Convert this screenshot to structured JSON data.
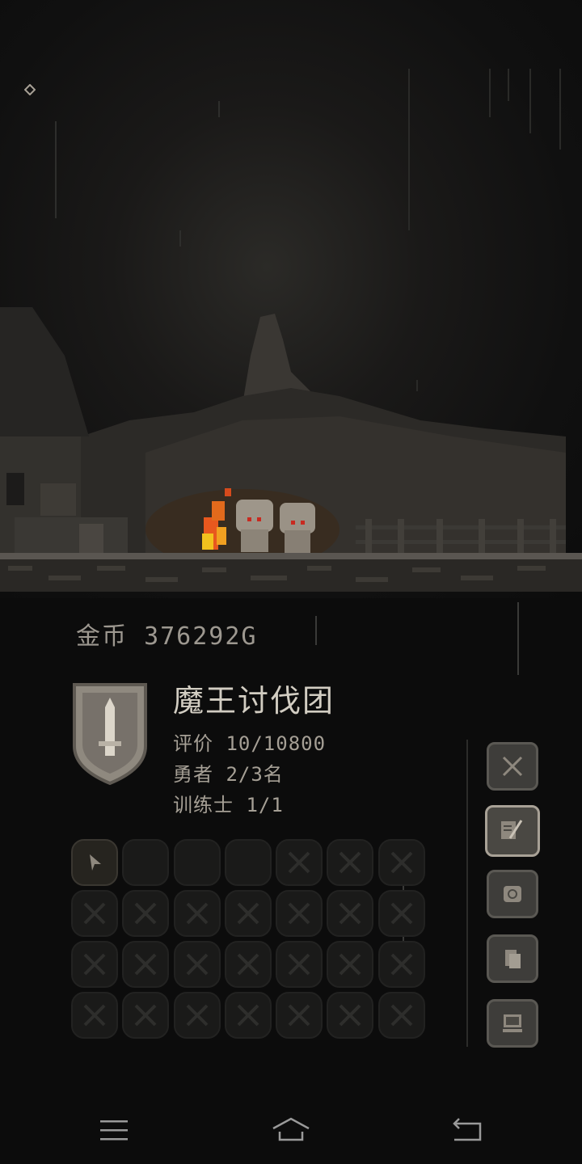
{
  "hud": {
    "gold_label": "金币",
    "gold_value": "376292G"
  },
  "team": {
    "name": "魔王讨伐团",
    "rating": "评价 10/10800",
    "heroes": "勇者 2/3名",
    "trainers": "训练士 1/1"
  },
  "icons": {
    "shield": "sword-shield-emblem-icon",
    "battle": "crossed-swords-icon",
    "quest": "quill-scroll-icon",
    "map": "map-scroll-icon",
    "files": "documents-icon",
    "computer": "computer-icon",
    "settings": "settings-ring-icon"
  },
  "slots": {
    "rows": 4,
    "cols": 7,
    "states": [
      "hero",
      "empty",
      "empty",
      "empty",
      "locked",
      "locked",
      "locked"
    ]
  },
  "colors": {
    "fire": "#e8581e",
    "ui_border": "#5a5853",
    "text_main": "#d2cdc2"
  }
}
